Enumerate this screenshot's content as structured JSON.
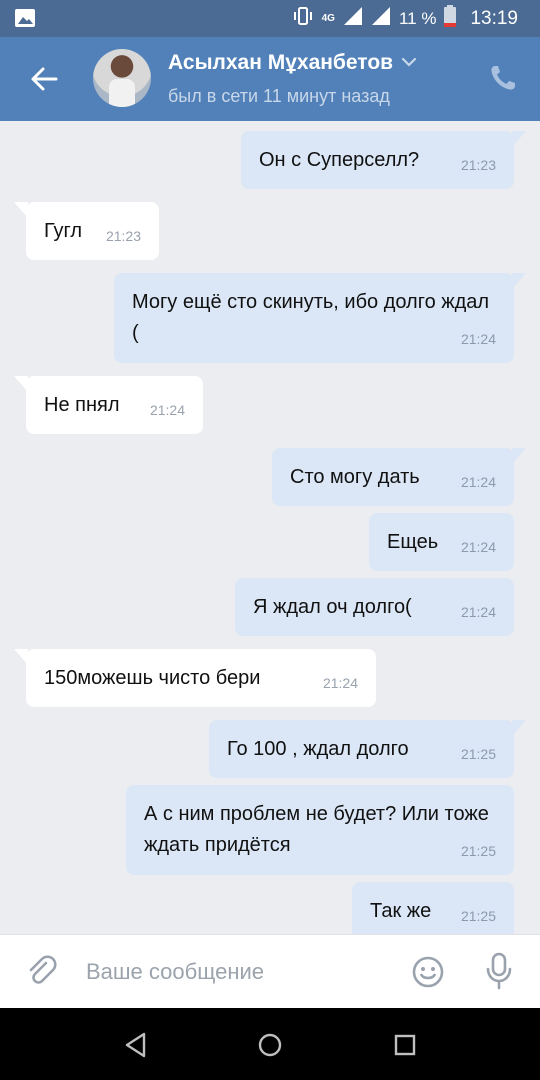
{
  "status_bar": {
    "network": "4G",
    "battery": "11 %",
    "time": "13:19"
  },
  "header": {
    "name": "Асылхан Мұханбетов",
    "status": "был в сети 11 минут назад"
  },
  "messages": [
    {
      "dir": "out",
      "text": "Он с Суперселл?",
      "time": "21:23"
    },
    {
      "dir": "in",
      "text": "Гугл",
      "time": "21:23"
    },
    {
      "dir": "out",
      "text": "Могу ещё сто скинуть, ибо долго ждал (",
      "time": "21:24"
    },
    {
      "dir": "in",
      "text": "Не пнял",
      "time": "21:24"
    },
    {
      "dir": "out",
      "text": "Сто могу дать",
      "time": "21:24"
    },
    {
      "dir": "out",
      "text": "Ещеь",
      "time": "21:24"
    },
    {
      "dir": "out",
      "text": "Я ждал оч долго(",
      "time": "21:24"
    },
    {
      "dir": "in",
      "text": "150можешь чисто бери",
      "time": "21:24"
    },
    {
      "dir": "out",
      "text": "Го 100 , ждал долго",
      "time": "21:25"
    },
    {
      "dir": "out",
      "text": "А с ним проблем не будет? Или тоже ждать придётся",
      "time": "21:25"
    },
    {
      "dir": "out",
      "text": "Так же",
      "time": "21:25"
    }
  ],
  "composer": {
    "placeholder": "Ваше сообщение"
  },
  "colors": {
    "header": "#5181b8",
    "status_bar": "#4b6b94",
    "chat_background": "#ebedf0",
    "outgoing_bubble": "#dbe7f6",
    "incoming_bubble": "#ffffff"
  },
  "icons": {
    "status_bar": [
      "image-icon",
      "vibrate-icon",
      "signal-icon",
      "battery-icon"
    ],
    "header": [
      "back-arrow-icon",
      "chevron-down-icon",
      "phone-icon"
    ],
    "composer": [
      "paperclip-icon",
      "emoji-icon",
      "microphone-icon"
    ],
    "nav": [
      "nav-back-icon",
      "nav-home-icon",
      "nav-recents-icon"
    ]
  }
}
